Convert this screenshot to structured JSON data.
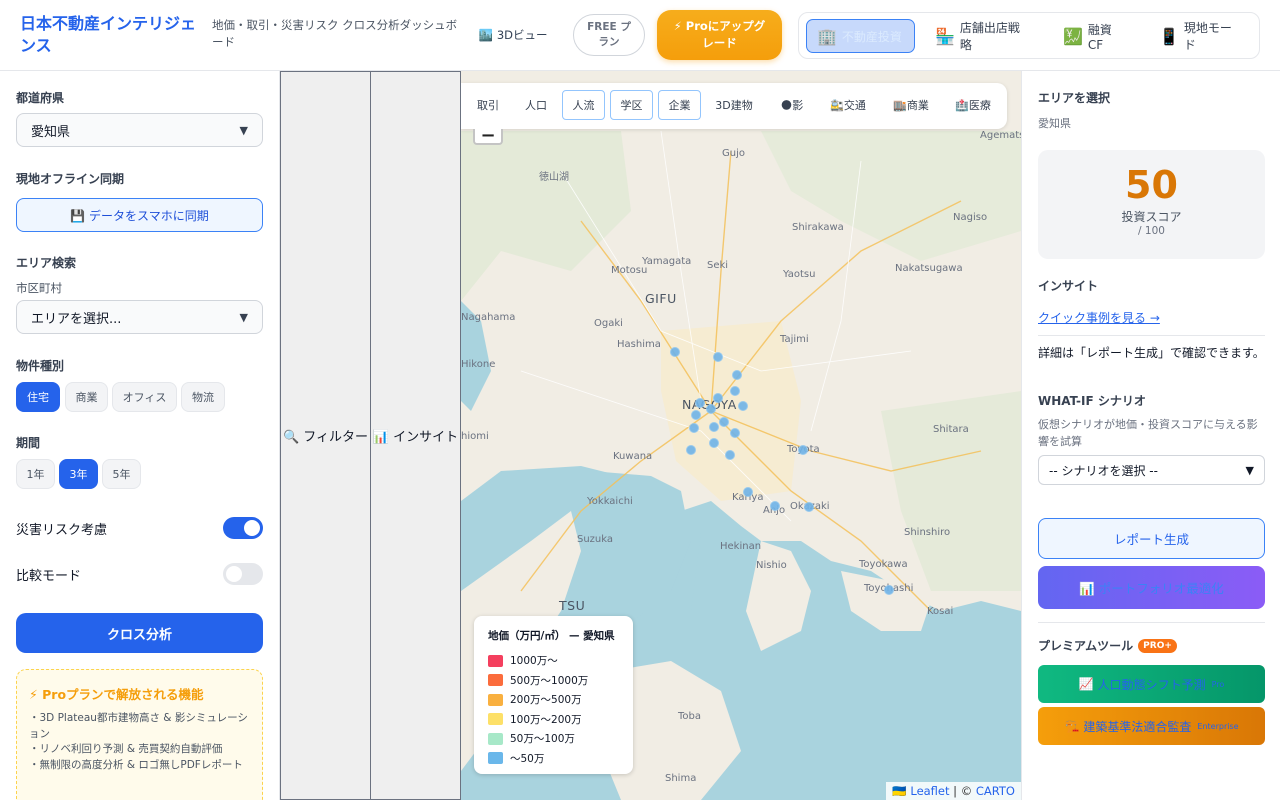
{
  "header": {
    "brand": "日本不動産インテリジェンス",
    "subtitle": "地価・取引・災害リスク クロス分析ダッシュボード",
    "view3d": "3Dビュー",
    "free_plan": "FREE プラン",
    "pro_upgrade": "⚡ Proにアップグレード",
    "modes": [
      {
        "label": "不動産投資",
        "icon": "🏢"
      },
      {
        "label": "店舗出店戦略",
        "icon": "🏪"
      },
      {
        "label": "融資CF",
        "icon": "💹"
      },
      {
        "label": "現地モード",
        "icon": "📱"
      }
    ]
  },
  "left": {
    "prefecture_label": "都道府県",
    "prefecture_value": "愛知県",
    "offline_label": "現地オフライン同期",
    "sync_button": "💾 データをスマホに同期",
    "area_search_label": "エリア検索",
    "city_label": "市区町村",
    "city_placeholder": "エリアを選択...",
    "property_label": "物件種別",
    "property_types": [
      "住宅",
      "商業",
      "オフィス",
      "物流"
    ],
    "period_label": "期間",
    "periods": [
      "1年",
      "3年",
      "5年"
    ],
    "disaster_label": "災害リスク考慮",
    "compare_label": "比較モード",
    "cross_button": "クロス分析",
    "pro_box": {
      "title": "⚡ Proプランで解放される機能",
      "items": [
        "・3D Plateau都市建物高さ & 影シミュレーション",
        "・リノベ利回り予測 & 売買契約自動評価",
        "・無制限の高度分析 & ロゴ無しPDFレポート"
      ]
    }
  },
  "panels": {
    "filter": "🔍 フィルター",
    "insight": "📊 インサイト"
  },
  "map": {
    "tabs": [
      "取引",
      "人口",
      "人流",
      "学区",
      "企業",
      "3D建物",
      "🌑影",
      "🚉交通",
      "🏬商業",
      "🏥医療"
    ],
    "zoom_out": "−",
    "places": [
      {
        "name": "Gujo",
        "big": false
      },
      {
        "name": "Agemats",
        "big": false
      },
      {
        "name": "徳山湖",
        "big": false
      },
      {
        "name": "Nagiso",
        "big": false
      },
      {
        "name": "Shirakawa",
        "big": false
      },
      {
        "name": "Yamagata",
        "big": false
      },
      {
        "name": "Motosu",
        "big": false
      },
      {
        "name": "Seki",
        "big": false
      },
      {
        "name": "Yaotsu",
        "big": false
      },
      {
        "name": "Nakatsugawa",
        "big": false
      },
      {
        "name": "GIFU",
        "big": true
      },
      {
        "name": "Nagahama",
        "big": false
      },
      {
        "name": "Ogaki",
        "big": false
      },
      {
        "name": "Tajimi",
        "big": false
      },
      {
        "name": "Hashima",
        "big": false
      },
      {
        "name": "Hikone",
        "big": false
      },
      {
        "name": "NAGOYA",
        "big": true
      },
      {
        "name": "hiomi",
        "big": false
      },
      {
        "name": "Shitara",
        "big": false
      },
      {
        "name": "Toyota",
        "big": false
      },
      {
        "name": "Kuwana",
        "big": false
      },
      {
        "name": "Yokkaichi",
        "big": false
      },
      {
        "name": "Kariya",
        "big": false
      },
      {
        "name": "Anjo",
        "big": false
      },
      {
        "name": "Okazaki",
        "big": false
      },
      {
        "name": "Suzuka",
        "big": false
      },
      {
        "name": "Shinshiro",
        "big": false
      },
      {
        "name": "Hekinan",
        "big": false
      },
      {
        "name": "Nishio",
        "big": false
      },
      {
        "name": "TSU",
        "big": true
      },
      {
        "name": "Toyokawa",
        "big": false
      },
      {
        "name": "Toyohashi",
        "big": false
      },
      {
        "name": "Kosai",
        "big": false
      },
      {
        "name": "Toba",
        "big": false
      },
      {
        "name": "Shima",
        "big": false
      }
    ],
    "legend": {
      "title": "地価（万円/㎡） — 愛知県",
      "items": [
        {
          "label": "1000万〜",
          "color": "#f43f5e"
        },
        {
          "label": "500万〜1000万",
          "color": "#fb6c3c"
        },
        {
          "label": "200万〜500万",
          "color": "#f9b040"
        },
        {
          "label": "100万〜200万",
          "color": "#fde068"
        },
        {
          "label": "50万〜100万",
          "color": "#a7e8c8"
        },
        {
          "label": "〜50万",
          "color": "#6ab7ea"
        }
      ]
    },
    "attribution": {
      "flag": "🇺🇦",
      "leaflet": "Leaflet",
      "sep": " | © ",
      "carto": "CARTO"
    }
  },
  "right": {
    "area_label": "エリアを選択",
    "area_value": "愛知県",
    "score": "50",
    "score_label": "投資スコア",
    "score_max": "/ 100",
    "insight_label": "インサイト",
    "quick_link": "クイック事例を見る →",
    "detail": "詳細は「レポート生成」で確認できます。",
    "whatif_label": "WHAT-IF シナリオ",
    "whatif_desc": "仮想シナリオが地価・投資スコアに与える影響を試算",
    "whatif_placeholder": "-- シナリオを選択 --",
    "report_button": "レポート生成",
    "portfolio_button": "📊 ポートフォリオ最適化",
    "premium_label": "プレミアムツール",
    "premium_badge": "PRO+",
    "premium_tools": [
      {
        "icon": "📈",
        "label": "人口動態シフト予測",
        "tier": "Pro"
      },
      {
        "icon": "🏗️",
        "label": "建築基準法適合監査",
        "tier": "Enterprise"
      }
    ]
  }
}
